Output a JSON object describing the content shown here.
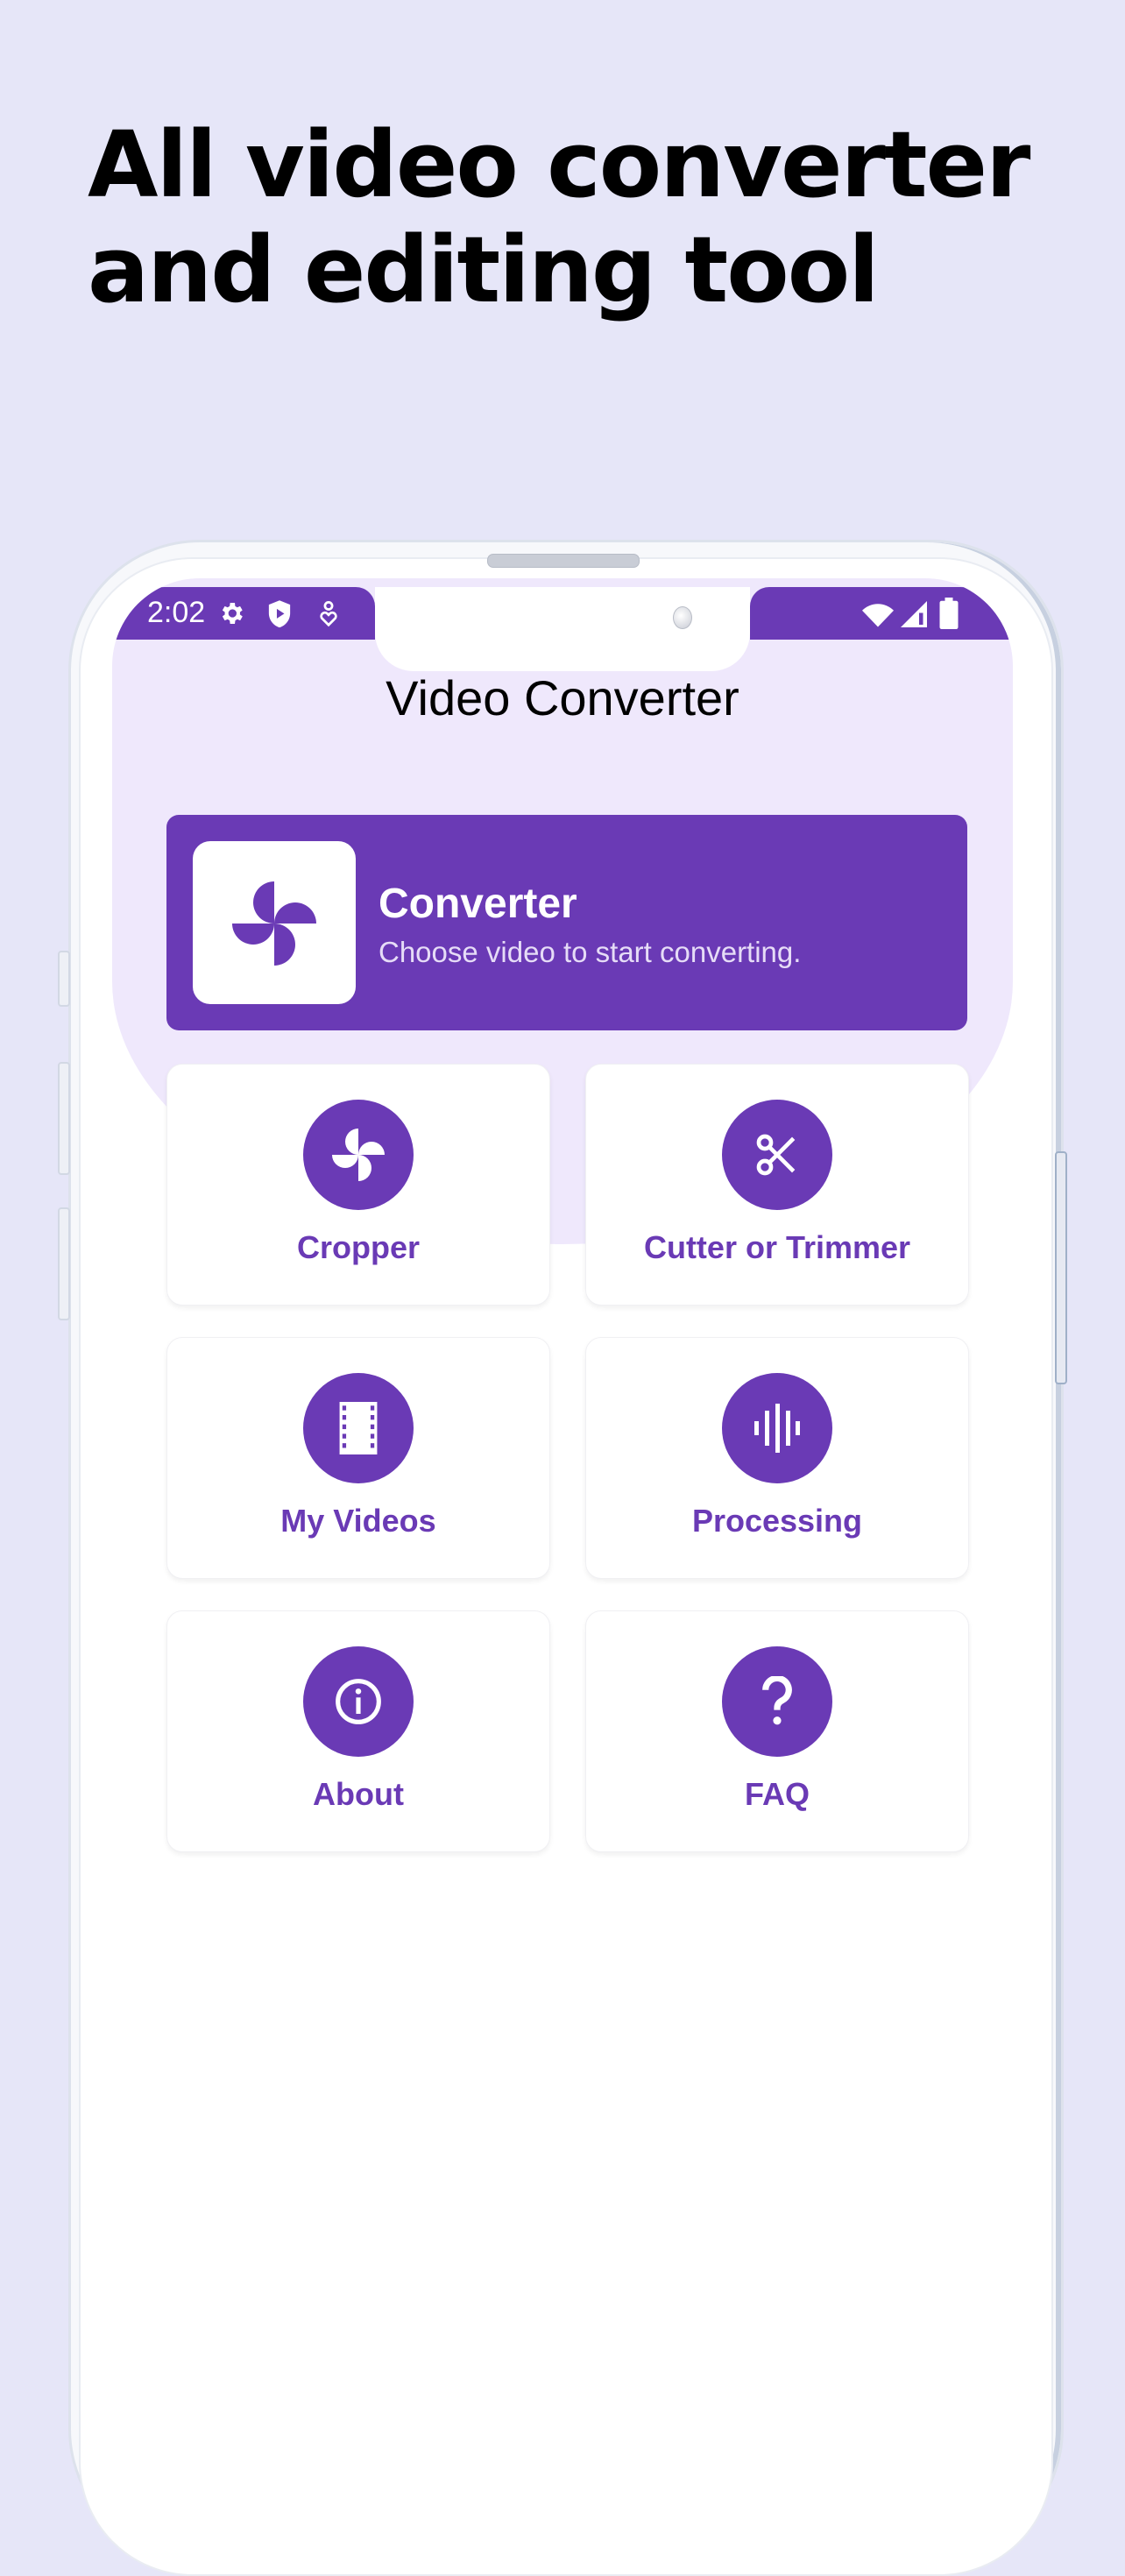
{
  "promo": {
    "headline_line1": "All video converter",
    "headline_line2": "and editing tool"
  },
  "statusbar": {
    "time": "2:02",
    "left_icons": [
      "settings-icon",
      "shield-play-icon",
      "accessibility-heart-icon"
    ],
    "right_icons": [
      "wifi-icon",
      "signal-icon",
      "battery-icon"
    ]
  },
  "app": {
    "title": "Video Converter",
    "accent_color": "#6a3ab5",
    "header_bg_color": "#efe8fc"
  },
  "converter_card": {
    "title": "Converter",
    "subtitle": "Choose video to start converting.",
    "icon": "pinwheel-icon"
  },
  "tiles": [
    {
      "label": "Cropper",
      "icon": "pinwheel-icon"
    },
    {
      "label": "Cutter or Trimmer",
      "icon": "scissors-icon"
    },
    {
      "label": "My Videos",
      "icon": "film-icon"
    },
    {
      "label": "Processing",
      "icon": "audio-wave-icon"
    },
    {
      "label": "About",
      "icon": "info-icon"
    },
    {
      "label": "FAQ",
      "icon": "question-icon"
    }
  ]
}
